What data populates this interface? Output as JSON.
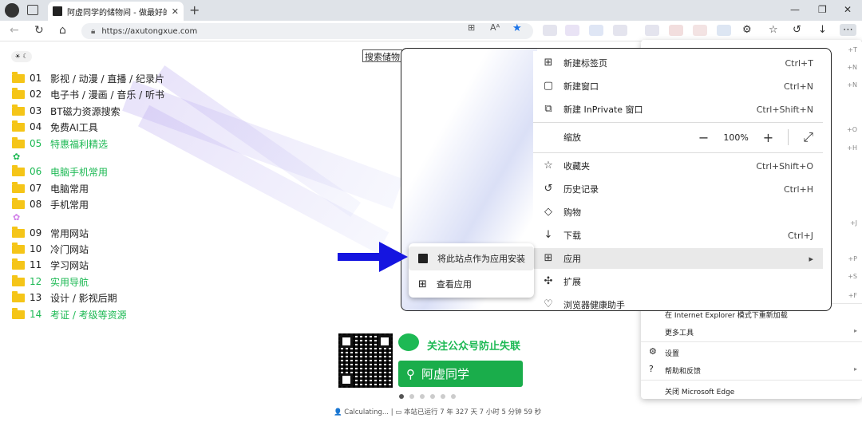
{
  "browser": {
    "tab_title": "阿虚同学的储物间 - 做最好的互联",
    "url": "https://axutongxue.com"
  },
  "page": {
    "theme_toggle": "☀ ☾",
    "items": [
      {
        "num": "01",
        "label": "影视 / 动漫 / 直播 / 纪录片",
        "green": false
      },
      {
        "num": "02",
        "label": "电子书 / 漫画 / 音乐 / 听书",
        "green": false
      },
      {
        "num": "03",
        "label": "BT磁力资源搜索",
        "green": false
      },
      {
        "num": "04",
        "label": "免费AI工具",
        "green": false
      },
      {
        "num": "05",
        "label": "特惠福利精选",
        "green": true
      },
      {
        "num": "06",
        "label": "电脑手机常用",
        "green": true
      },
      {
        "num": "07",
        "label": "电脑常用",
        "green": false
      },
      {
        "num": "08",
        "label": "手机常用",
        "green": false
      },
      {
        "num": "09",
        "label": "常用网站",
        "green": false
      },
      {
        "num": "10",
        "label": "冷门网站",
        "green": false
      },
      {
        "num": "11",
        "label": "学习网站",
        "green": false
      },
      {
        "num": "12",
        "label": "实用导航",
        "green": true
      },
      {
        "num": "13",
        "label": "设计 / 影视后期",
        "green": false
      },
      {
        "num": "14",
        "label": "考证 / 考级等资源",
        "green": true
      }
    ],
    "search_box": "搜索储物",
    "wechat_text": "关注公众号防止失联",
    "green_button": "阿虚同学",
    "footer": "👤 Calculating... | ▭ 本站已运行 7 年 327 天 7 小时 5 分钟 59 秒"
  },
  "menu": {
    "items": [
      {
        "icon": "new-tab-icon",
        "glyph": "⊞",
        "label": "新建标签页",
        "shortcut": "Ctrl+T"
      },
      {
        "icon": "new-window-icon",
        "glyph": "▢",
        "label": "新建窗口",
        "shortcut": "Ctrl+N"
      },
      {
        "icon": "inprivate-icon",
        "glyph": "⧉",
        "label": "新建 InPrivate 窗口",
        "shortcut": "Ctrl+Shift+N"
      },
      {
        "icon": "zoom-icon",
        "glyph": "",
        "label": "缩放",
        "shortcut": ""
      },
      {
        "icon": "favorites-icon",
        "glyph": "☆",
        "label": "收藏夹",
        "shortcut": "Ctrl+Shift+O"
      },
      {
        "icon": "history-icon",
        "glyph": "↺",
        "label": "历史记录",
        "shortcut": "Ctrl+H"
      },
      {
        "icon": "shopping-icon",
        "glyph": "◇",
        "label": "购物",
        "shortcut": ""
      },
      {
        "icon": "download-icon",
        "glyph": "↓",
        "label": "下载",
        "shortcut": "Ctrl+J"
      },
      {
        "icon": "apps-icon",
        "glyph": "⊞",
        "label": "应用",
        "shortcut": "▸"
      },
      {
        "icon": "extensions-icon",
        "glyph": "✣",
        "label": "扩展",
        "shortcut": ""
      },
      {
        "icon": "health-icon",
        "glyph": "♡",
        "label": "浏览器健康助手",
        "shortcut": ""
      }
    ],
    "zoom": {
      "minus": "−",
      "value": "100%",
      "plus": "+",
      "fullscreen": "⤢"
    }
  },
  "submenu": {
    "install_label": "将此站点作为应用安装",
    "view_label": "查看应用"
  },
  "bgmenu": {
    "items": [
      {
        "label": "在 Internet Explorer 模式下重新加载",
        "key": ""
      },
      {
        "label": "更多工具",
        "key": "▸"
      },
      {
        "label": "设置",
        "key": ""
      },
      {
        "label": "帮助和反馈",
        "key": "▸"
      },
      {
        "label": "关闭 Microsoft Edge",
        "key": ""
      }
    ],
    "right_keys": [
      "+T",
      "+N",
      "+N",
      "+O",
      "+H",
      "+J",
      "+P",
      "+S",
      "+F"
    ]
  }
}
